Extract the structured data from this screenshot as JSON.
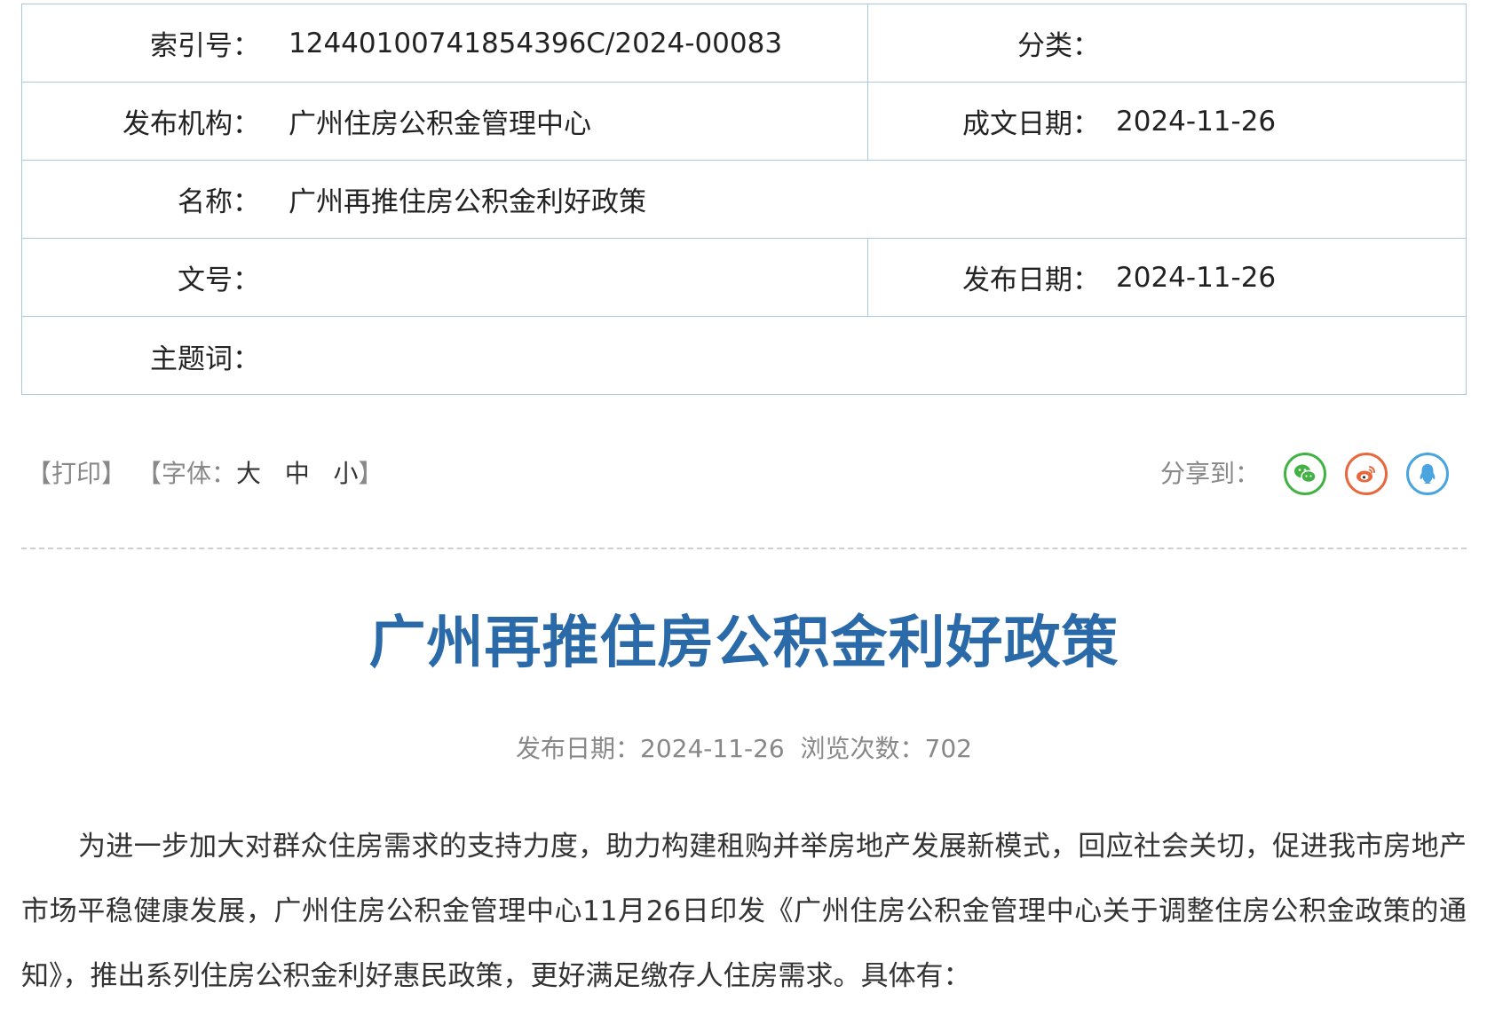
{
  "meta": {
    "rows": [
      {
        "left_label": "索引号：",
        "left_value": "12440100741854396C/2024-00083",
        "right_label": "分类：",
        "right_value": ""
      },
      {
        "left_label": "发布机构：",
        "left_value": "广州住房公积金管理中心",
        "right_label": "成文日期：",
        "right_value": "2024-11-26"
      },
      {
        "left_label": "名称：",
        "left_value": "广州再推住房公积金利好政策"
      },
      {
        "left_label": "文号：",
        "left_value": "",
        "right_label": "发布日期：",
        "right_value": "2024-11-26"
      },
      {
        "left_label": "主题词：",
        "left_value": ""
      }
    ]
  },
  "toolbar": {
    "print_label": "【打印】",
    "font_label_prefix": "【字体：",
    "font_large": "大",
    "font_medium": "中",
    "font_small": "小",
    "font_label_suffix": "】",
    "share_label": "分享到：",
    "share_icons": [
      "wechat-icon",
      "weibo-icon",
      "qq-icon"
    ],
    "colors": {
      "wechat": "#43b244",
      "weibo": "#e8673d",
      "qq": "#4aa4e0"
    }
  },
  "article": {
    "title": "广州再推住房公积金利好政策",
    "meta_line": "发布日期：2024-11-26  浏览次数：702",
    "body": "为进一步加大对群众住房需求的支持力度，助力构建租购并举房地产发展新模式，回应社会关切，促进我市房地产市场平稳健康发展，广州住房公积金管理中心11月26日印发《广州住房公积金管理中心关于调整住房公积金政策的通知》，推出系列住房公积金利好惠民政策，更好满足缴存人住房需求。具体有："
  },
  "colors": {
    "title": "#2a6aa8",
    "border": "#a9c8e0",
    "muted": "#888888"
  }
}
